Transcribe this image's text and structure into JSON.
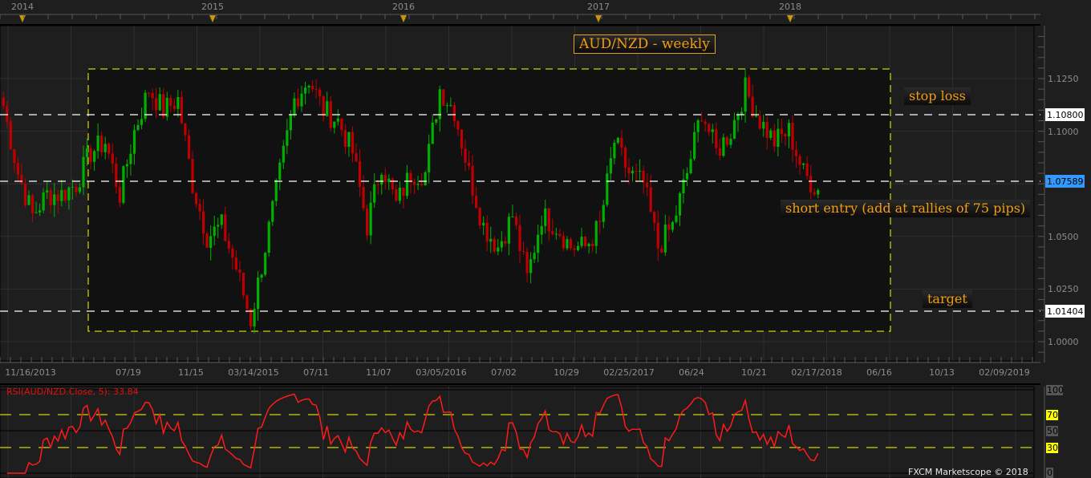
{
  "chart_data": {
    "type": "candlestick",
    "symbol": "AUD/NZD",
    "title": "AUD/NZD - weekly",
    "years": [
      "2014",
      "2015",
      "2016",
      "2017",
      "2018"
    ],
    "date_ticks": [
      "11/16/2013",
      "07/19",
      "11/15",
      "03/14/2015",
      "07/11",
      "11/07",
      "03/05/2016",
      "07/02",
      "10/29",
      "02/25/2017",
      "06/24",
      "10/21",
      "02/17/2018",
      "06/16",
      "10/13",
      "02/09/2019"
    ],
    "price_ticks": [
      "1.1250",
      "1.1000",
      "1.0500",
      "1.0250",
      "1.0000"
    ],
    "ylim": [
      1.0,
      1.14
    ],
    "approx_close_path": [
      1.112,
      1.08,
      1.06,
      1.07,
      1.07,
      1.075,
      1.09,
      1.095,
      1.07,
      1.1,
      1.12,
      1.11,
      1.115,
      1.075,
      1.05,
      1.055,
      1.035,
      1.01,
      1.045,
      1.08,
      1.115,
      1.125,
      1.11,
      1.105,
      1.09,
      1.055,
      1.085,
      1.065,
      1.08,
      1.08,
      1.12,
      1.11,
      1.08,
      1.055,
      1.045,
      1.06,
      1.03,
      1.06,
      1.055,
      1.045,
      1.045,
      1.055,
      1.095,
      1.08,
      1.075,
      1.045,
      1.055,
      1.08,
      1.11,
      1.09,
      1.1,
      1.12,
      1.105,
      1.095,
      1.1,
      1.08,
      1.072
    ],
    "levels": {
      "stop_loss": {
        "label": "stop loss",
        "value": "1.10800"
      },
      "entry": {
        "label": "short entry (add at rallies of 75 pips)",
        "value": "1.07589"
      },
      "target": {
        "label": "target",
        "value": "1.01404"
      }
    },
    "range_box": {
      "high": 1.13,
      "low": 1.004
    },
    "colors": {
      "up": "#00b000",
      "down": "#c00000",
      "box": "#ffff00",
      "rsi": "#ff1a1a",
      "current": "#3399ff"
    }
  },
  "rsi": {
    "label": "RSI(AUD/NZD.Close, 5): 33.84",
    "ticks": [
      "100",
      "70",
      "50",
      "30",
      "0"
    ],
    "overbought": 70,
    "oversold": 30
  },
  "footer": {
    "copyright": "FXCM Marketscope © 2018"
  }
}
